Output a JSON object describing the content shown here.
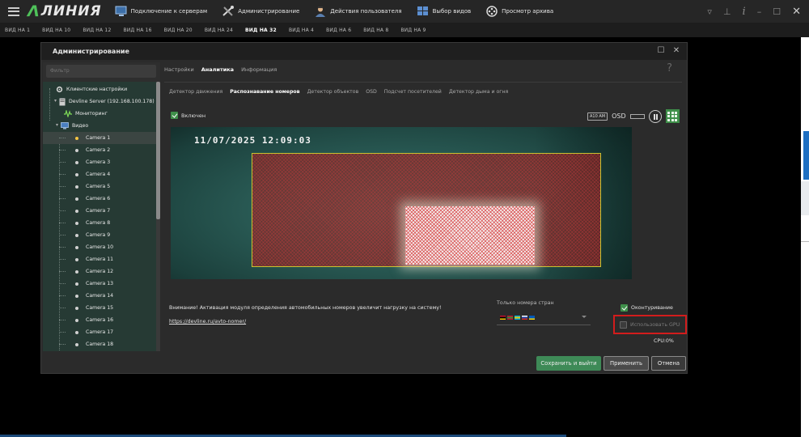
{
  "app": {
    "logo_text": "ЛИНИЯ",
    "menu": [
      {
        "label": "Подключение к серверам",
        "icon": "monitor-icon"
      },
      {
        "label": "Администрирование",
        "icon": "tools-icon"
      },
      {
        "label": "Действия пользователя",
        "icon": "user-icon"
      },
      {
        "label": "Выбор видов",
        "icon": "views-icon"
      },
      {
        "label": "Просмотр архива",
        "icon": "film-icon"
      }
    ],
    "right_icons": [
      "filter-icon",
      "pin-icon",
      "info-icon",
      "minimize-icon",
      "maximize-icon",
      "close-icon"
    ]
  },
  "views": [
    {
      "label": "ВИД НА 1"
    },
    {
      "label": "ВИД НА 10"
    },
    {
      "label": "ВИД НА 12"
    },
    {
      "label": "ВИД НА 16"
    },
    {
      "label": "ВИД НА 20"
    },
    {
      "label": "ВИД НА 24"
    },
    {
      "label": "ВИД НА 32",
      "active": true
    },
    {
      "label": "ВИД НА 4"
    },
    {
      "label": "ВИД НА 6"
    },
    {
      "label": "ВИД НА 8"
    },
    {
      "label": "ВИД НА 9"
    }
  ],
  "dialog": {
    "title": "Администрирование",
    "filter_placeholder": "Фильтр",
    "tree": {
      "client_settings": "Клиентские настройки",
      "server": "Devline Server (192.168.100.178)",
      "monitoring": "Мониторинг",
      "video": "Видео",
      "cameras": [
        "Camera 1",
        "Camera 2",
        "Camera 3",
        "Camera 4",
        "Camera 5",
        "Camera 6",
        "Camera 7",
        "Camera 8",
        "Camera 9",
        "Camera 10",
        "Camera 11",
        "Camera 12",
        "Camera 13",
        "Camera 14",
        "Camera 15",
        "Camera 16",
        "Camera 17",
        "Camera 18"
      ],
      "selected": "Camera 1"
    },
    "tabs_top": [
      {
        "label": "Настройки"
      },
      {
        "label": "Аналитика",
        "active": true
      },
      {
        "label": "Информация"
      }
    ],
    "help_glyph": "?",
    "tabs_analytics": [
      {
        "label": "Детектор движения"
      },
      {
        "label": "Распознавание номеров",
        "active": true
      },
      {
        "label": "Детектор объектов"
      },
      {
        "label": "OSD"
      },
      {
        "label": "Подсчет посетителей"
      },
      {
        "label": "Детектор дыма и огня"
      }
    ],
    "enabled_label": "Включен",
    "enabled": true,
    "cam_tools": {
      "badge": "A10 AM",
      "osd": "OSD"
    },
    "video_timestamp": "11/07/2025   12:09:03",
    "warning": "Внимание! Активация модуля определения автомобильных номеров увеличит нагрузку на систему!",
    "link": "https://devline.ru/avto-nomer/",
    "countries_label": "Только номера стран",
    "flags": [
      {
        "top": "#c8102e",
        "mid": "#000000",
        "bot": "#f2c300"
      },
      {
        "top": "#c8102e",
        "mid": "#2e8b3a",
        "bot": "#c8102e"
      },
      {
        "top": "#00aee0",
        "mid": "#f2c300",
        "bot": "#00aee0"
      },
      {
        "top": "#ffffff",
        "mid": "#1c3fa0",
        "bot": "#d52b1e"
      },
      {
        "top": "#0057b7",
        "mid": "#0057b7",
        "bot": "#ffd700"
      }
    ],
    "outline_label": "Оконтуривание",
    "outline": true,
    "gpu_label": "Использовать GPU",
    "gpu": false,
    "cpu_label": "CPU:0%",
    "buttons": {
      "save_exit": "Сохранить и выйти",
      "apply": "Применить",
      "cancel": "Отмена"
    }
  },
  "colors": {
    "accent_green": "#3f8f4a",
    "highlight_red": "#d21c1c",
    "roi_border": "#c8c230"
  }
}
